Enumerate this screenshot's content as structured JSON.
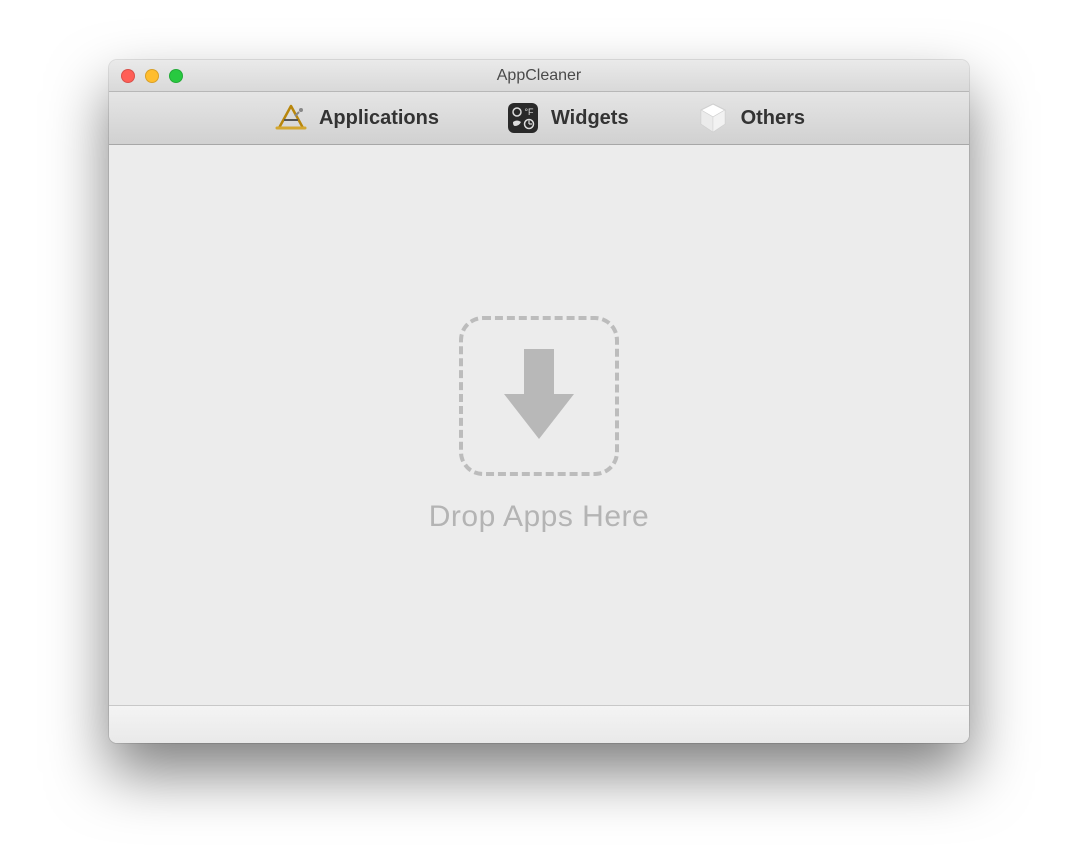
{
  "window": {
    "title": "AppCleaner"
  },
  "tabs": [
    {
      "label": "Applications",
      "icon": "applications-icon"
    },
    {
      "label": "Widgets",
      "icon": "widgets-icon"
    },
    {
      "label": "Others",
      "icon": "others-icon"
    }
  ],
  "dropzone": {
    "label": "Drop Apps Here"
  }
}
